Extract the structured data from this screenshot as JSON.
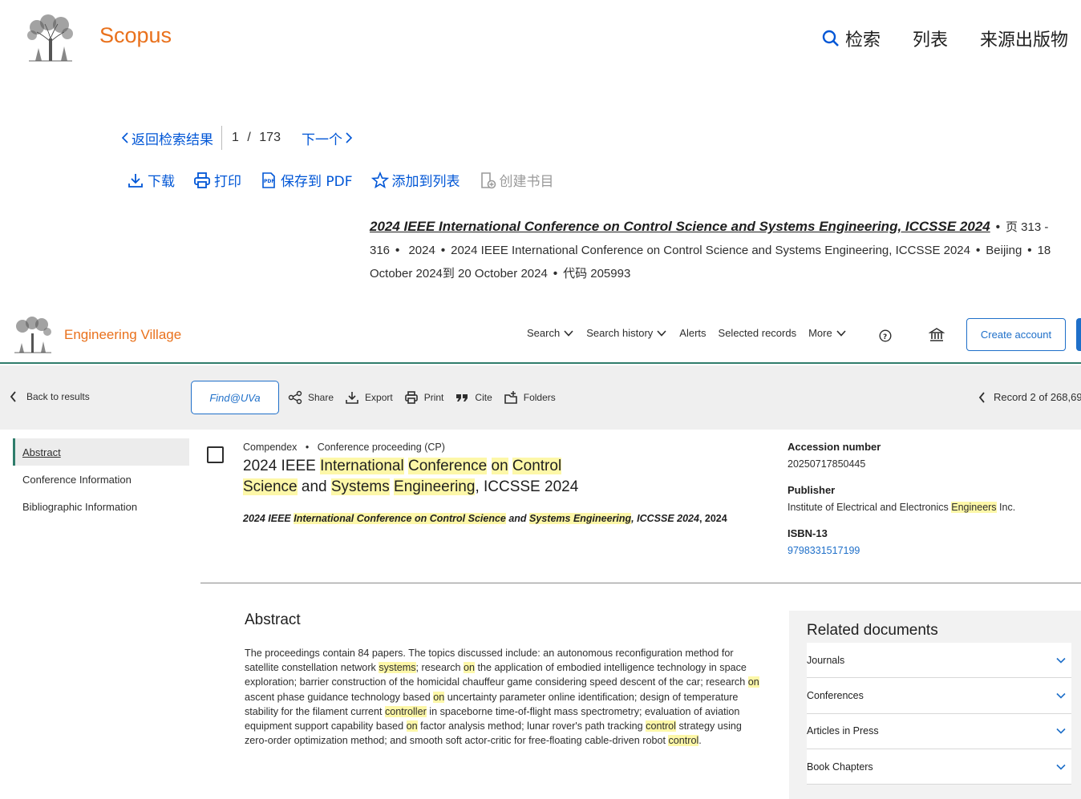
{
  "scopus": {
    "brand": "Scopus",
    "nav": {
      "search": "检索",
      "lists": "列表",
      "sources": "来源出版物"
    },
    "pager": {
      "back": "返回检索结果",
      "current": "1",
      "separator": "/",
      "total": "173",
      "next": "下一个"
    },
    "toolbar": {
      "download": "下载",
      "print": "打印",
      "save_pdf": "保存到 PDF",
      "add_list": "添加到列表",
      "create_bib": "创建书目"
    },
    "source": {
      "title": "2024 IEEE International Conference on Control Science and Systems Engineering, ICCSSE 2024",
      "pages": "页 313 - 316",
      "year": "2024",
      "conference": "2024 IEEE International Conference on Control Science and Systems Engineering, ICCSSE 2024",
      "location": "Beijing",
      "dates": "18 October 2024到 20 October 2024",
      "code": "代码 205993"
    }
  },
  "ev": {
    "brand": "Engineering Village",
    "nav": {
      "search": "Search",
      "history": "Search history",
      "alerts": "Alerts",
      "selected": "Selected records",
      "more": "More"
    },
    "create_account": "Create account",
    "bar": {
      "back": "Back to results",
      "find": "Find@UVa",
      "share": "Share",
      "export": "Export",
      "print": "Print",
      "cite": "Cite",
      "folders": "Folders",
      "record": "Record 2 of 268,69"
    },
    "sidebar": [
      "Abstract",
      "Conference Information",
      "Bibliographic Information"
    ],
    "record": {
      "database": "Compendex",
      "doctype": "Conference proceeding (CP)",
      "title_parts": [
        "2024 IEEE ",
        "International",
        " ",
        "Conference",
        " ",
        "on",
        " ",
        "Control",
        " ",
        "Science",
        " and ",
        "Systems",
        " ",
        "Engineering",
        ", ICCSSE 2024"
      ],
      "source_parts": [
        "2024 IEEE ",
        "International Conference on Control Science",
        " and ",
        "Systems Engineering",
        ", ICCSSE 2024",
        ", 2024"
      ]
    },
    "details": {
      "accession_label": "Accession number",
      "accession": "20250717850445",
      "publisher_label": "Publisher",
      "publisher_pre": "Institute of Electrical and Electronics ",
      "publisher_hl": "Engineers",
      "publisher_post": " Inc.",
      "isbn_label": "ISBN-13",
      "isbn": "9798331517199"
    },
    "abstract": {
      "heading": "Abstract",
      "parts": [
        "The proceedings contain 84 papers. The topics discussed include: an autonomous reconfiguration method for satellite constellation network ",
        "systems",
        "; research ",
        "on",
        " the application of embodied intelligence technology in space exploration; barrier construction of the homicidal chauffeur game considering speed descent of the car; research ",
        "on",
        " ascent phase guidance technology based ",
        "on",
        " uncertainty parameter online identification; design of temperature stability for the filament current ",
        "controller",
        " in spaceborne time-of-flight mass spectrometry; evaluation of aviation equipment support capability based ",
        "on",
        " factor analysis method; lunar rover's path tracking ",
        "control",
        " strategy using zero-order optimization method; and smooth soft actor-critic for free-floating cable-driven robot ",
        "control",
        "."
      ]
    },
    "related": {
      "heading": "Related documents",
      "items": [
        "Journals",
        "Conferences",
        "Articles in Press",
        "Book Chapters"
      ]
    }
  }
}
